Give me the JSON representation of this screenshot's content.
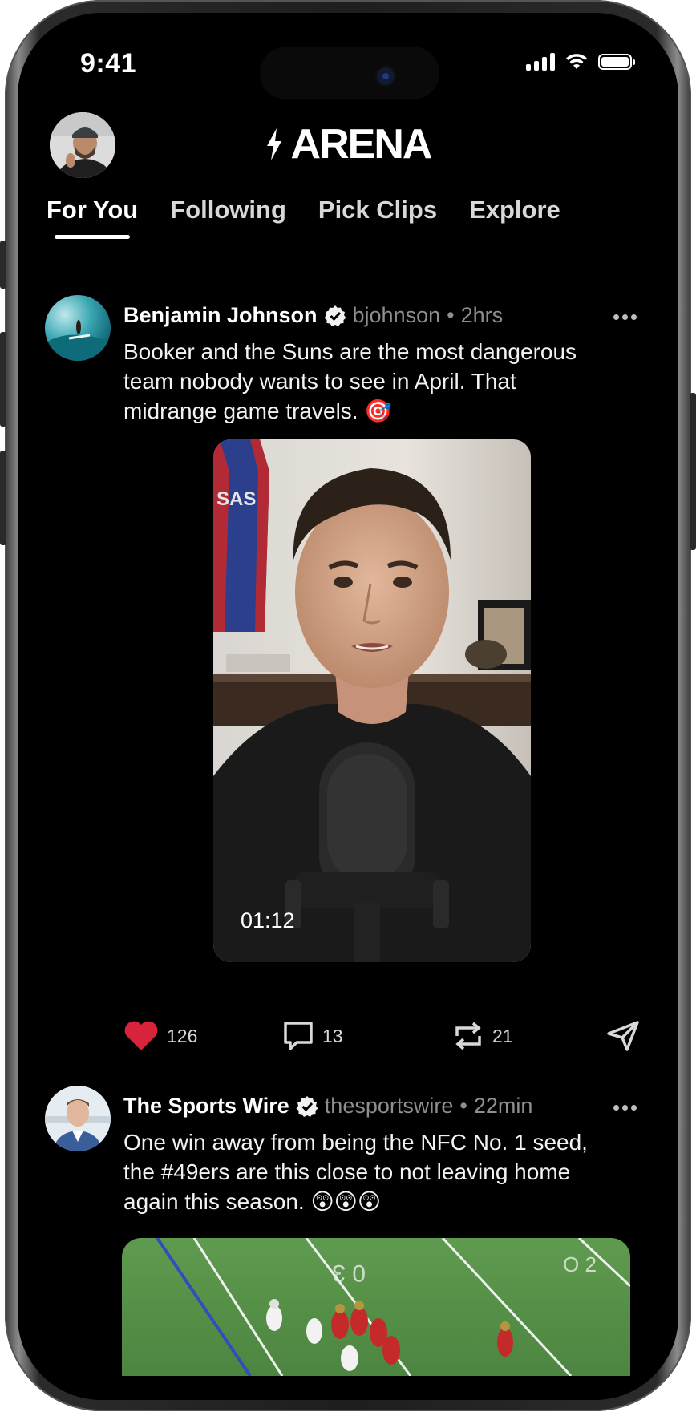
{
  "status_bar": {
    "time": "9:41"
  },
  "header": {
    "logo_text": "ARENA"
  },
  "tabs": [
    {
      "label": "For You",
      "active": true
    },
    {
      "label": "Following",
      "active": false
    },
    {
      "label": "Pick Clips",
      "active": false
    },
    {
      "label": "Explore",
      "active": false
    }
  ],
  "posts": [
    {
      "name": "Benjamin Johnson",
      "verified": true,
      "handle": "bjohnson",
      "separator": "•",
      "time": "2hrs",
      "text": "Booker and the Suns are the most dangerous team nobody wants to see in April. That midrange game travels. 🎯",
      "media": {
        "type": "video",
        "duration": "01:12"
      },
      "stats": {
        "likes": "126",
        "comments": "13",
        "reposts": "21"
      },
      "liked": true
    },
    {
      "name": "The Sports Wire",
      "verified": true,
      "handle": "thesportswire",
      "separator": "•",
      "time": "22min",
      "text": "One win away from being the NFC No. 1 seed, the #49ers are this close to not leaving home again this season. 😲😲😲",
      "media": {
        "type": "image"
      }
    }
  ],
  "colors": {
    "background": "#000000",
    "like": "#d9233a",
    "muted": "#8e8e8e",
    "text": "#ffffff"
  },
  "icons": [
    "bolt-icon",
    "verified-icon",
    "more-icon",
    "heart-icon",
    "comment-icon",
    "repost-icon",
    "share-icon",
    "signal-icon",
    "wifi-icon",
    "battery-icon"
  ]
}
